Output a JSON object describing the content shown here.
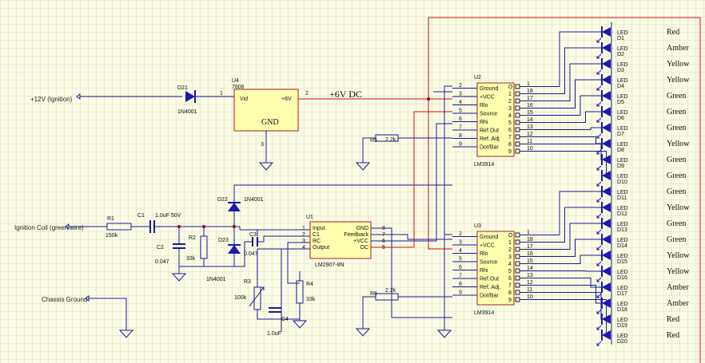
{
  "sources": {
    "ignition": "+12V (Ignition)",
    "coil": "Ignition Coil (green wire)",
    "ground": "Chassis Ground"
  },
  "rail": "+6V DC",
  "u4": {
    "ref": "U4",
    "part": "7806",
    "vin": "Vid",
    "out": "+6V",
    "gnd": "GND",
    "pin1": "1",
    "pin2": "2",
    "pin3": "3"
  },
  "d21": {
    "ref": "D21",
    "part": "1N4001"
  },
  "d22": {
    "ref": "D22",
    "part": "1N4001"
  },
  "d23": {
    "ref": "D23",
    "part": "1N4001"
  },
  "r1": {
    "ref": "R1",
    "val": "150k"
  },
  "r2": {
    "ref": "R2",
    "val": "33k"
  },
  "r3": {
    "ref": "R3",
    "val": "100k"
  },
  "r4": {
    "ref": "R4",
    "val": "33k"
  },
  "r5": {
    "ref": "R5",
    "val": "2.2k"
  },
  "r6": {
    "ref": "R6",
    "val": "2.2k"
  },
  "c1": {
    "ref": "C1",
    "val": "1.0uF 50V"
  },
  "c2": {
    "ref": "C2",
    "val": "0.047"
  },
  "c3": {
    "ref": "C3",
    "val": "0.047"
  },
  "c4": {
    "ref": "C4",
    "val": "1.0uF"
  },
  "u1": {
    "ref": "U1",
    "part": "LM2907-8N",
    "pins_left": [
      "Input",
      "C1",
      "RC",
      "Output"
    ],
    "pins_right": [
      "GND",
      "Feedback",
      "+VCC",
      "OC"
    ],
    "nums_left": [
      "1",
      "2",
      "3",
      "4"
    ],
    "nums_right": [
      "8",
      "7",
      "6",
      "5"
    ]
  },
  "u2": {
    "ref": "U2",
    "part": "LM3914"
  },
  "u3": {
    "ref": "U3",
    "part": "LM3914"
  },
  "lm3914": {
    "left_pins": [
      "Ground",
      "+VCC",
      "Rlo",
      "Source",
      "Rhi",
      "Ref.Out",
      "Ref. Adj.",
      "Dot/Bar"
    ],
    "left_nums": [
      "2",
      "3",
      "4",
      "5",
      "6",
      "7",
      "8",
      "9"
    ],
    "right_pins": [
      "O",
      "1",
      "2",
      "3",
      "4",
      "5",
      "6",
      "7",
      "8",
      "9"
    ],
    "right_nums": [
      "1",
      "18",
      "17",
      "16",
      "15",
      "14",
      "13",
      "12",
      "11",
      "10"
    ]
  },
  "leds": {
    "type": "LED",
    "refs": [
      "D1",
      "D2",
      "D3",
      "D4",
      "D5",
      "D6",
      "D7",
      "D8",
      "D9",
      "D10",
      "D11",
      "D12",
      "D13",
      "D14",
      "D15",
      "D16",
      "D17",
      "D18",
      "D19",
      "D20"
    ],
    "colors": [
      "Red",
      "Amber",
      "Yellow",
      "Yellow",
      "Green",
      "Green",
      "Green",
      "Yellow",
      "Green",
      "Green",
      "Green",
      "Yellow",
      "Green",
      "Green",
      "Yellow",
      "Yellow",
      "Amber",
      "Amber",
      "Red",
      "Red"
    ]
  },
  "colors": {
    "wire": "#1a1a99",
    "rail": "#cc1111",
    "node": "#aa0000",
    "diode": "#1a1aaa",
    "ic": "#ffffb0",
    "grid": "#d8d8b0"
  }
}
